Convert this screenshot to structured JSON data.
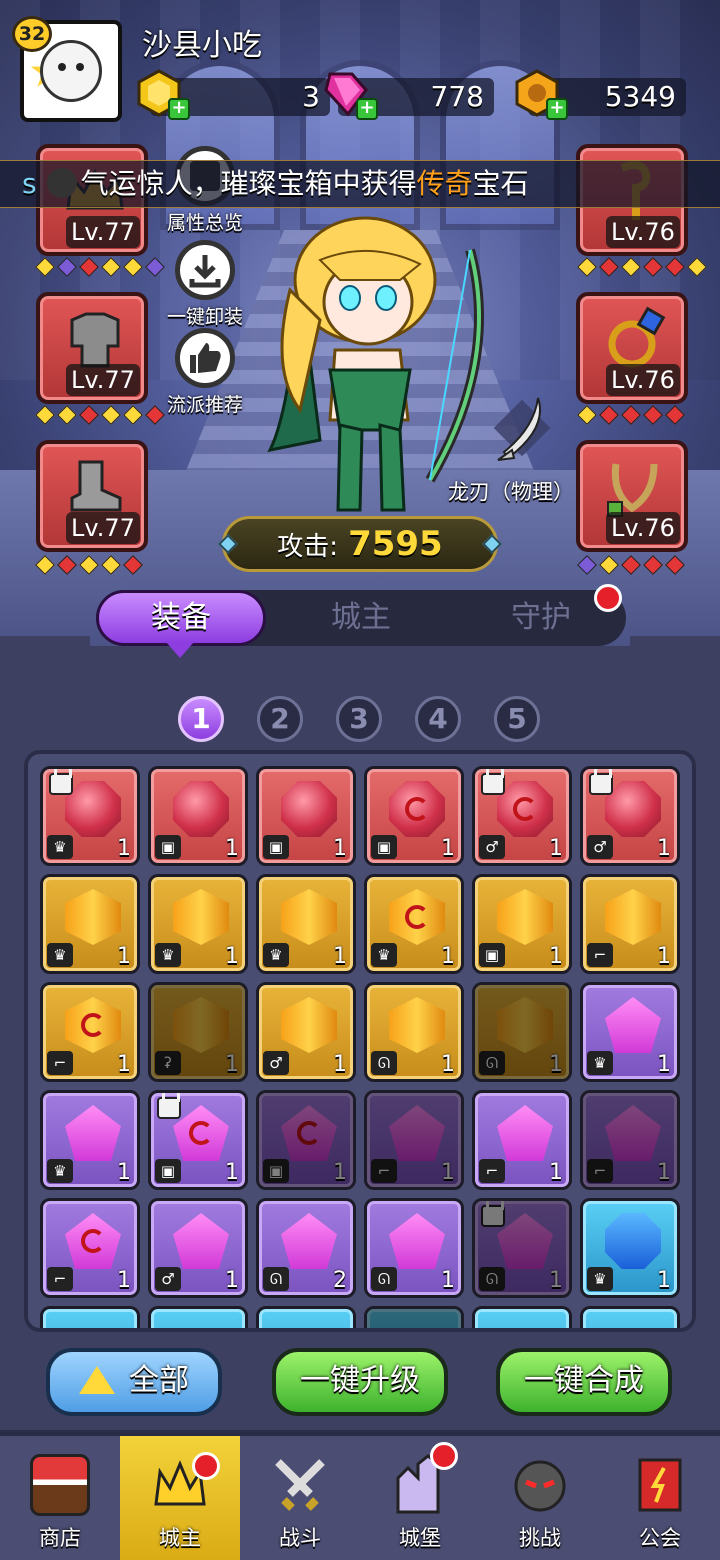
{
  "player": {
    "level": "32",
    "name": "沙县小吃"
  },
  "currencies": [
    {
      "name": "gold-crystal",
      "value": "3",
      "color": "#f5c61a"
    },
    {
      "name": "pink-gem",
      "value": "778",
      "color": "#e0319e"
    },
    {
      "name": "gold-coin",
      "value": "5349",
      "color": "#f5a51a"
    }
  ],
  "broadcast": {
    "prefix": "s",
    "text_main": "气运惊人，璀璨宝箱中获得",
    "text_highlight": "传奇",
    "text_tail": "宝石"
  },
  "side_buttons": [
    {
      "label": "属性总览"
    },
    {
      "label": "一键卸装"
    },
    {
      "label": "流派推荐"
    }
  ],
  "left_slots": [
    {
      "level": "Lv.77",
      "icon": "crown-icon",
      "diamonds": [
        "#ffd83a",
        "#7c5cd6",
        "#e43636",
        "#ffd83a",
        "#ffd83a",
        "#7c5cd6"
      ]
    },
    {
      "level": "Lv.77",
      "icon": "armor-icon",
      "diamonds": [
        "#ffd83a",
        "#ffd83a",
        "#e43636",
        "#ffd83a",
        "#ffd83a",
        "#e43636"
      ]
    },
    {
      "level": "Lv.77",
      "icon": "boot-icon",
      "diamonds": [
        "#ffd83a",
        "#e43636",
        "#ffd83a",
        "#ffd83a",
        "#e43636"
      ]
    }
  ],
  "right_slots": [
    {
      "level": "Lv.76",
      "icon": "staff-icon",
      "diamonds": [
        "#ffd83a",
        "#e43636",
        "#ffd83a",
        "#e43636",
        "#e43636",
        "#ffd83a"
      ]
    },
    {
      "level": "Lv.76",
      "icon": "ring-icon",
      "diamonds": [
        "#ffd83a",
        "#e43636",
        "#e43636",
        "#e43636",
        "#e43636"
      ]
    },
    {
      "level": "Lv.76",
      "icon": "necklace-icon",
      "diamonds": [
        "#7c5cd6",
        "#ffd83a",
        "#e43636",
        "#e43636",
        "#e43636"
      ]
    }
  ],
  "weapon": {
    "name": "龙刃（物理）"
  },
  "attack": {
    "label": "攻击:",
    "value": "7595"
  },
  "tabs": [
    {
      "label": "装备",
      "active": true
    },
    {
      "label": "城主",
      "active": false
    },
    {
      "label": "守护",
      "active": false
    }
  ],
  "pages": [
    "1",
    "2",
    "3",
    "4",
    "5"
  ],
  "active_page": "1",
  "inventory": [
    {
      "color": "red",
      "gem": "red-g",
      "swirl": false,
      "lock": true,
      "type": "♛",
      "count": "1",
      "dim": false
    },
    {
      "color": "red",
      "gem": "red-g",
      "swirl": false,
      "lock": false,
      "type": "▣",
      "count": "1",
      "dim": false
    },
    {
      "color": "red",
      "gem": "red-g",
      "swirl": false,
      "lock": false,
      "type": "▣",
      "count": "1",
      "dim": false
    },
    {
      "color": "red",
      "gem": "red-g",
      "swirl": true,
      "lock": false,
      "type": "▣",
      "count": "1",
      "dim": false
    },
    {
      "color": "red",
      "gem": "red-g",
      "swirl": true,
      "lock": true,
      "type": "♂",
      "count": "1",
      "dim": false
    },
    {
      "color": "red",
      "gem": "red-g",
      "swirl": false,
      "lock": true,
      "type": "♂",
      "count": "1",
      "dim": false
    },
    {
      "color": "gold",
      "gem": "gold-g",
      "swirl": false,
      "lock": false,
      "type": "♛",
      "count": "1",
      "dim": false
    },
    {
      "color": "gold",
      "gem": "gold-g",
      "swirl": false,
      "lock": false,
      "type": "♛",
      "count": "1",
      "dim": false
    },
    {
      "color": "gold",
      "gem": "gold-g",
      "swirl": false,
      "lock": false,
      "type": "♛",
      "count": "1",
      "dim": false
    },
    {
      "color": "gold",
      "gem": "gold-g",
      "swirl": true,
      "lock": false,
      "type": "♛",
      "count": "1",
      "dim": false
    },
    {
      "color": "gold",
      "gem": "gold-g",
      "swirl": false,
      "lock": false,
      "type": "▣",
      "count": "1",
      "dim": false
    },
    {
      "color": "gold",
      "gem": "gold-g",
      "swirl": false,
      "lock": false,
      "type": "⌐",
      "count": "1",
      "dim": false
    },
    {
      "color": "gold",
      "gem": "gold-g",
      "swirl": true,
      "lock": false,
      "type": "⌐",
      "count": "1",
      "dim": false
    },
    {
      "color": "gold",
      "gem": "gold-g",
      "swirl": false,
      "lock": false,
      "type": "ʡ",
      "count": "1",
      "dim": true
    },
    {
      "color": "gold",
      "gem": "gold-g",
      "swirl": false,
      "lock": false,
      "type": "♂",
      "count": "1",
      "dim": false
    },
    {
      "color": "gold",
      "gem": "gold-g",
      "swirl": false,
      "lock": false,
      "type": "ᘏ",
      "count": "1",
      "dim": false
    },
    {
      "color": "gold",
      "gem": "gold-g",
      "swirl": false,
      "lock": false,
      "type": "ᘏ",
      "count": "1",
      "dim": true
    },
    {
      "color": "purple",
      "gem": "purple-g",
      "swirl": false,
      "lock": false,
      "type": "♛",
      "count": "1",
      "dim": false
    },
    {
      "color": "purple",
      "gem": "purple-g",
      "swirl": false,
      "lock": false,
      "type": "♛",
      "count": "1",
      "dim": false
    },
    {
      "color": "purple",
      "gem": "purple-g",
      "swirl": true,
      "lock": true,
      "type": "▣",
      "count": "1",
      "dim": false
    },
    {
      "color": "purple",
      "gem": "purple-g",
      "swirl": true,
      "lock": false,
      "type": "▣",
      "count": "1",
      "dim": true
    },
    {
      "color": "purple",
      "gem": "purple-g",
      "swirl": false,
      "lock": false,
      "type": "⌐",
      "count": "1",
      "dim": true
    },
    {
      "color": "purple",
      "gem": "purple-g",
      "swirl": false,
      "lock": false,
      "type": "⌐",
      "count": "1",
      "dim": false
    },
    {
      "color": "purple",
      "gem": "purple-g",
      "swirl": false,
      "lock": false,
      "type": "⌐",
      "count": "1",
      "dim": true
    },
    {
      "color": "purple",
      "gem": "purple-g",
      "swirl": true,
      "lock": false,
      "type": "⌐",
      "count": "1",
      "dim": false
    },
    {
      "color": "purple",
      "gem": "purple-g",
      "swirl": false,
      "lock": false,
      "type": "♂",
      "count": "1",
      "dim": false
    },
    {
      "color": "purple",
      "gem": "purple-g",
      "swirl": false,
      "lock": false,
      "type": "ᘏ",
      "count": "2",
      "dim": false
    },
    {
      "color": "purple",
      "gem": "purple-g",
      "swirl": false,
      "lock": false,
      "type": "ᘏ",
      "count": "1",
      "dim": false
    },
    {
      "color": "purple",
      "gem": "purple-g",
      "swirl": false,
      "lock": true,
      "type": "ᘏ",
      "count": "1",
      "dim": true
    },
    {
      "color": "blue",
      "gem": "blue-g",
      "swirl": false,
      "lock": false,
      "type": "♛",
      "count": "1",
      "dim": false
    }
  ],
  "actions": [
    {
      "label": "全部",
      "style": "blue"
    },
    {
      "label": "一键升级",
      "style": "green"
    },
    {
      "label": "一键合成",
      "style": "green"
    }
  ],
  "nav": [
    {
      "label": "商店",
      "icon": "shop-icon",
      "active": false,
      "dot": false
    },
    {
      "label": "城主",
      "icon": "lord-icon",
      "active": true,
      "dot": true
    },
    {
      "label": "战斗",
      "icon": "battle-icon",
      "active": false,
      "dot": false
    },
    {
      "label": "城堡",
      "icon": "castle-icon",
      "active": false,
      "dot": true
    },
    {
      "label": "挑战",
      "icon": "challenge-icon",
      "active": false,
      "dot": false
    },
    {
      "label": "公会",
      "icon": "guild-icon",
      "active": false,
      "dot": false
    }
  ]
}
